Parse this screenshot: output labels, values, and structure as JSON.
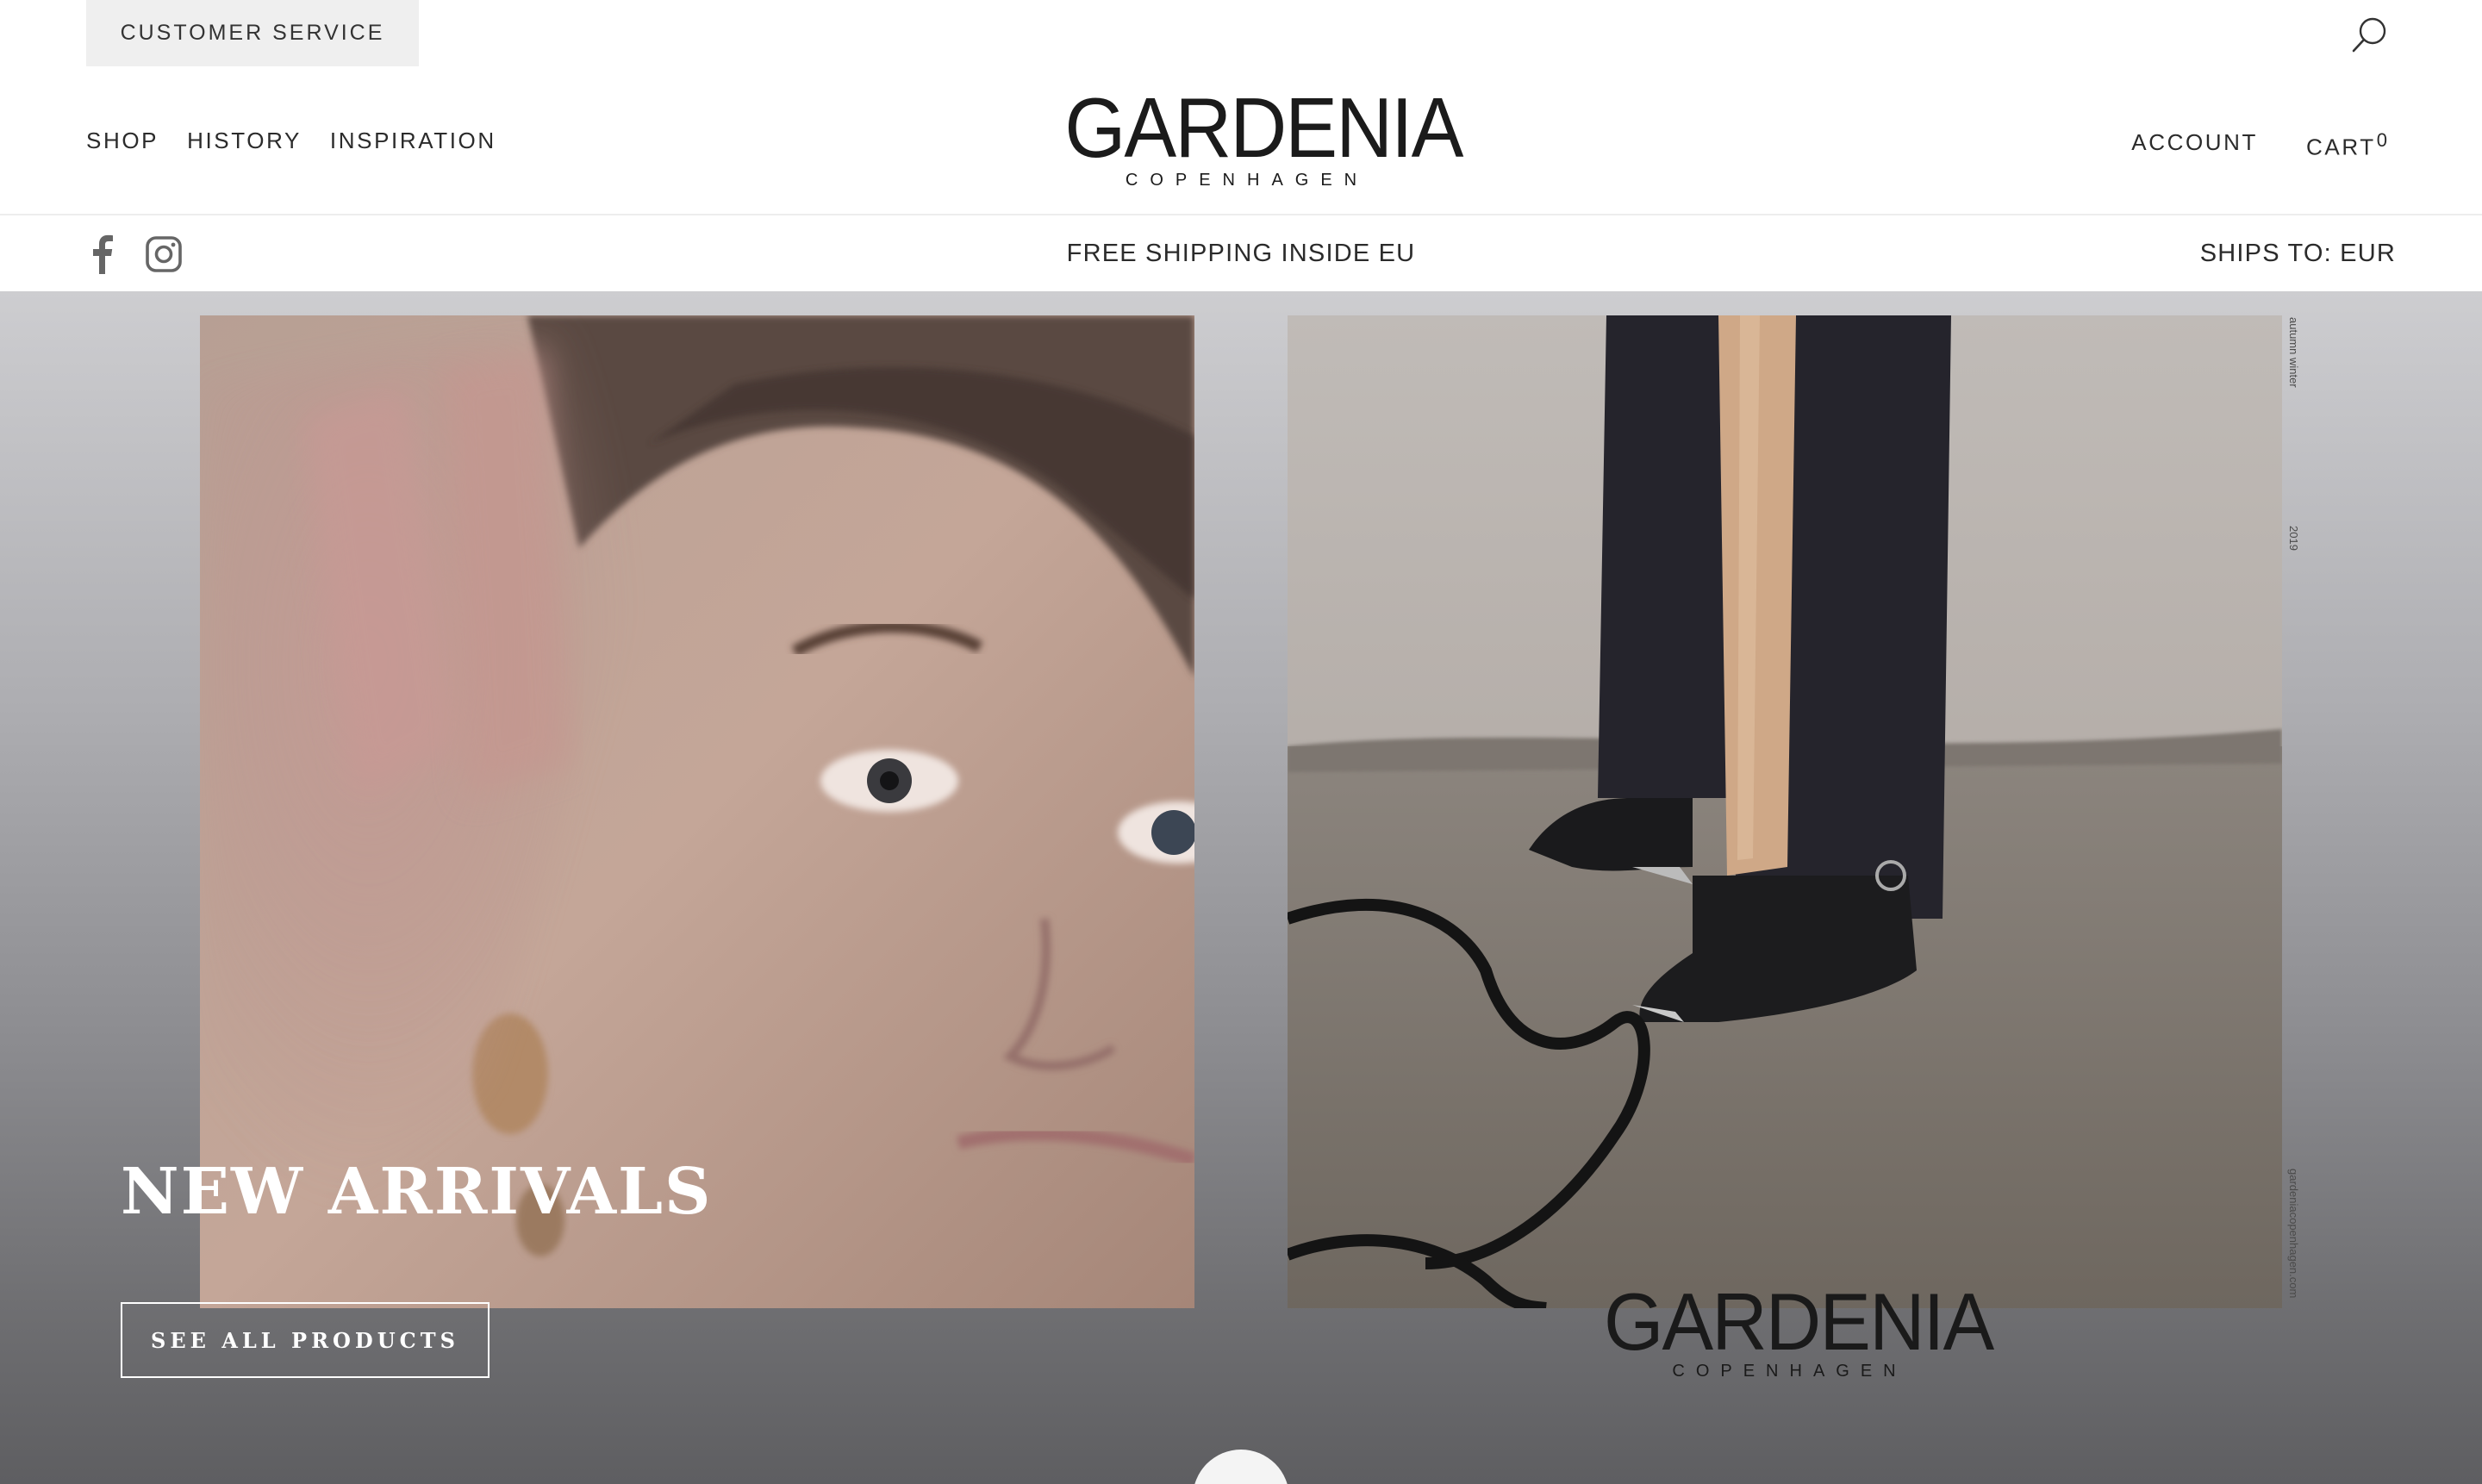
{
  "utility": {
    "customer_service": "CUSTOMER SERVICE",
    "search_icon": "search-icon"
  },
  "header": {
    "nav_left": [
      "SHOP",
      "HISTORY",
      "INSPIRATION"
    ],
    "logo_main": "GARDENIA",
    "logo_sub": "COPENHAGEN",
    "account": "ACCOUNT",
    "cart": "CART",
    "cart_count": "0"
  },
  "announcement": {
    "social_icons": [
      "facebook-icon",
      "instagram-icon"
    ],
    "text": "FREE SHIPPING INSIDE EU",
    "ships_to": "SHIPS TO: EUR"
  },
  "hero": {
    "title": "NEW ARRIVALS",
    "cta": "SEE ALL PRODUCTS",
    "side_text_top": "autumn winter",
    "side_text_mid": "2019",
    "side_text_bottom": "gardeniacopenhagen.com",
    "logo_main": "GARDENIA",
    "logo_sub": "COPENHAGEN"
  },
  "colors": {
    "text": "#2b2b2b",
    "tab_bg": "#efefef",
    "hero_white": "#ffffff"
  }
}
